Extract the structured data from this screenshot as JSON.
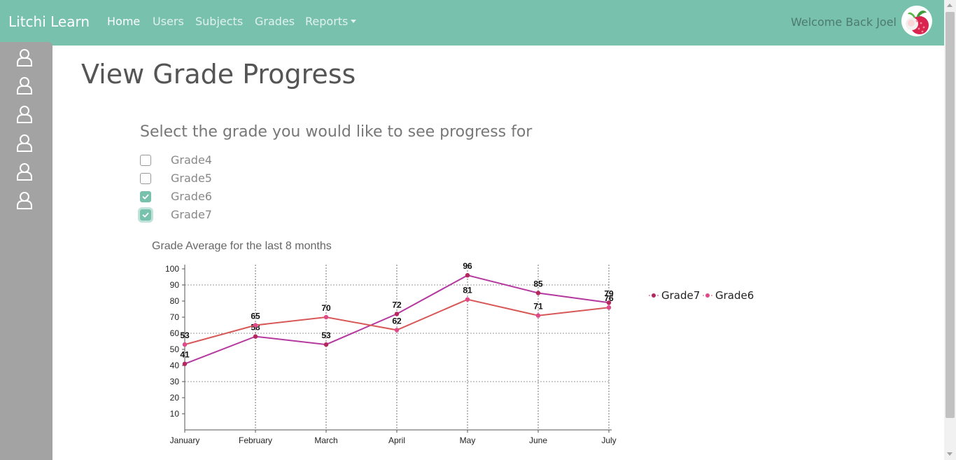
{
  "navbar": {
    "brand": "Litchi Learn",
    "links": [
      {
        "label": "Home",
        "active": true
      },
      {
        "label": "Users",
        "active": false
      },
      {
        "label": "Subjects",
        "active": false
      },
      {
        "label": "Grades",
        "active": false
      },
      {
        "label": "Reports",
        "active": false,
        "dropdown": true
      }
    ],
    "welcome": "Welcome Back Joel",
    "avatar_icon": "lychee-avatar-icon",
    "accent_color": "#78c1ad"
  },
  "sidebar": {
    "items": [
      {
        "icon": "user-icon"
      },
      {
        "icon": "user-icon"
      },
      {
        "icon": "user-icon"
      },
      {
        "icon": "user-icon"
      },
      {
        "icon": "user-icon"
      },
      {
        "icon": "user-icon"
      }
    ]
  },
  "main": {
    "title": "View Grade Progress",
    "prompt": "Select the grade you would like to see progress for",
    "grades": [
      {
        "label": "Grade4",
        "checked": false
      },
      {
        "label": "Grade5",
        "checked": false
      },
      {
        "label": "Grade6",
        "checked": true
      },
      {
        "label": "Grade7",
        "checked": true
      }
    ]
  },
  "chart_data": {
    "type": "line",
    "title": "Grade Average for the last 8 months",
    "categories": [
      "January",
      "February",
      "March",
      "April",
      "May",
      "June",
      "July"
    ],
    "ylim": [
      0,
      100
    ],
    "yticks": [
      10,
      20,
      30,
      40,
      50,
      60,
      70,
      80,
      90,
      100
    ],
    "series": [
      {
        "name": "Grade7",
        "values": [
          41,
          58,
          53,
          72,
          96,
          85,
          79
        ],
        "color": "#b5389e",
        "marker_color": "#b5285e"
      },
      {
        "name": "Grade6",
        "values": [
          53,
          65,
          70,
          62,
          81,
          71,
          76
        ],
        "color": "#d85858",
        "marker_color": "#df4a8a"
      }
    ],
    "grid": true,
    "legend": "right"
  }
}
